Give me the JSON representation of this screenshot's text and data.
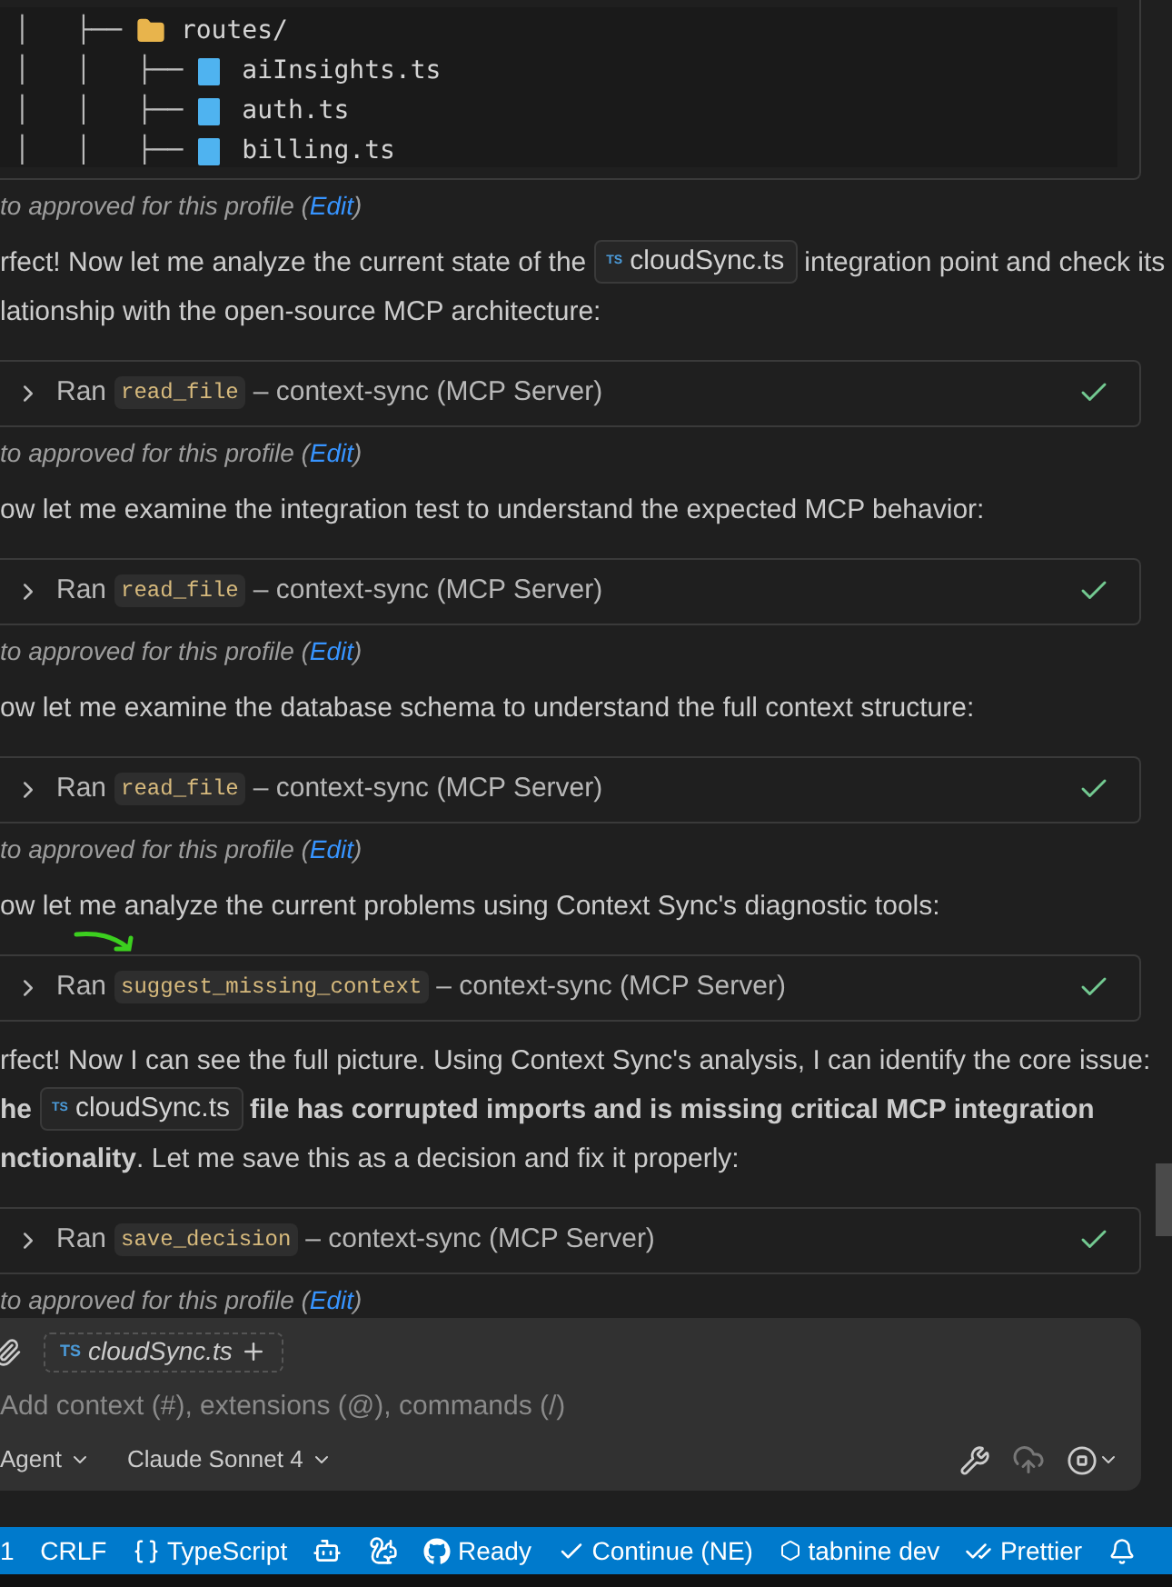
{
  "tree": [
    {
      "prefix": "│   ├── ",
      "kind": "folder",
      "name": "routes/"
    },
    {
      "prefix": "│   │   ├── ",
      "kind": "file",
      "name": "aiInsights.ts"
    },
    {
      "prefix": "│   │   ├── ",
      "kind": "file",
      "name": "auth.ts"
    },
    {
      "prefix": "│   │   ├── ",
      "kind": "file",
      "name": "billing.ts"
    }
  ],
  "messages": [
    {
      "kind": "approval",
      "text": "to approved for this profile (",
      "link": "Edit",
      "end": ")"
    },
    {
      "kind": "paragraph",
      "lines": [
        [
          {
            "kind": "text",
            "text": "rfect! Now let me analyze the current state of the"
          },
          {
            "kind": "file",
            "icon": "TS",
            "text": "cloudSync.ts"
          },
          {
            "kind": "text",
            "text": "integration point and check its"
          }
        ],
        [
          {
            "kind": "text",
            "text": "lationship with the open-source MCP architecture:"
          }
        ]
      ]
    },
    {
      "kind": "tool",
      "verb": "Ran",
      "tool": "read_file",
      "server": "– context-sync (MCP Server)",
      "done": true
    },
    {
      "kind": "approval",
      "text": "to approved for this profile (",
      "link": "Edit",
      "end": ")"
    },
    {
      "kind": "paragraph",
      "lines": [
        [
          {
            "kind": "text",
            "text": "ow let me examine the integration test to understand the expected MCP behavior:"
          }
        ]
      ]
    },
    {
      "kind": "tool",
      "verb": "Ran",
      "tool": "read_file",
      "server": "– context-sync (MCP Server)",
      "done": true
    },
    {
      "kind": "approval",
      "text": "to approved for this profile (",
      "link": "Edit",
      "end": ")"
    },
    {
      "kind": "paragraph",
      "lines": [
        [
          {
            "kind": "text",
            "text": "ow let me examine the database schema to understand the full context structure:"
          }
        ]
      ]
    },
    {
      "kind": "tool",
      "verb": "Ran",
      "tool": "read_file",
      "server": "– context-sync (MCP Server)",
      "done": true
    },
    {
      "kind": "approval",
      "text": "to approved for this profile (",
      "link": "Edit",
      "end": ")"
    },
    {
      "kind": "paragraph",
      "lines": [
        [
          {
            "kind": "text",
            "text": "ow let me analyze the current problems using Context Sync's diagnostic tools:"
          }
        ]
      ]
    },
    {
      "kind": "tool",
      "verb": "Ran",
      "tool": "suggest_missing_context",
      "server": "– context-sync (MCP Server)",
      "done": true
    },
    {
      "kind": "paragraph",
      "lines": [
        [
          {
            "kind": "text",
            "text": "rfect! Now I can see the full picture. Using Context Sync's analysis, I can identify the core issue:"
          }
        ],
        [
          {
            "kind": "text",
            "text": "**he**"
          },
          {
            "kind": "file",
            "icon": "TS",
            "text": "cloudSync.ts"
          },
          {
            "kind": "text",
            "text": "**file has corrupted imports and is missing critical MCP integration**"
          }
        ],
        [
          {
            "kind": "text",
            "text": "**nctionality**. Let me save this as a decision and fix it properly:"
          }
        ]
      ]
    },
    {
      "kind": "tool",
      "verb": "Ran",
      "tool": "save_decision",
      "server": "– context-sync (MCP Server)",
      "done": true
    },
    {
      "kind": "approval",
      "text": "to approved for this profile (",
      "link": "Edit",
      "end": ")"
    }
  ],
  "chat": {
    "attachment": {
      "icon": "TS",
      "name": "cloudSync.ts"
    },
    "placeholder": "Add context (#), extensions (@), commands (/)",
    "mode": "Agent",
    "model": "Claude Sonnet 4"
  },
  "status_bar": [
    {
      "kind": "text",
      "text": "1"
    },
    {
      "kind": "text",
      "text": "CRLF"
    },
    {
      "kind": "braces",
      "text": "TypeScript"
    },
    {
      "kind": "copilot"
    },
    {
      "kind": "squirrel"
    },
    {
      "kind": "github",
      "text": "Ready"
    },
    {
      "kind": "check",
      "text": "Continue (NE)"
    },
    {
      "kind": "hexagon",
      "text": "tabnine dev"
    },
    {
      "kind": "checkall",
      "text": "Prettier"
    },
    {
      "kind": "bell"
    }
  ]
}
